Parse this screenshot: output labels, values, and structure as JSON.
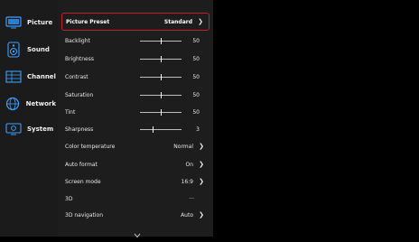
{
  "sidebar": {
    "items": [
      {
        "label": "Picture",
        "icon": "tv-icon"
      },
      {
        "label": "Sound",
        "icon": "speaker-icon"
      },
      {
        "label": "Channel",
        "icon": "channel-grid-icon"
      },
      {
        "label": "Network",
        "icon": "globe-icon"
      },
      {
        "label": "System",
        "icon": "settings-tv-icon"
      }
    ]
  },
  "menu": {
    "preset": {
      "label": "Picture Preset",
      "value": "Standard"
    },
    "sliders": [
      {
        "label": "Backlight",
        "value": "50",
        "level": 0.5
      },
      {
        "label": "Brightness",
        "value": "50",
        "level": 0.5
      },
      {
        "label": "Contrast",
        "value": "50",
        "level": 0.5
      },
      {
        "label": "Saturation",
        "value": "50",
        "level": 0.5
      },
      {
        "label": "Tint",
        "value": "50",
        "level": 0.5
      },
      {
        "label": "Sharpness",
        "value": "3",
        "level": 0.3
      }
    ],
    "options": [
      {
        "label": "Color temperature",
        "value": "Normal",
        "chevron": true
      },
      {
        "label": "Auto format",
        "value": "On",
        "chevron": true
      },
      {
        "label": "Screen mode",
        "value": "16:9",
        "chevron": true
      },
      {
        "label": "3D",
        "value": "···",
        "chevron": false
      },
      {
        "label": "3D navigation",
        "value": "Auto",
        "chevron": true
      }
    ]
  },
  "colors": {
    "accent": "#c0202a"
  }
}
